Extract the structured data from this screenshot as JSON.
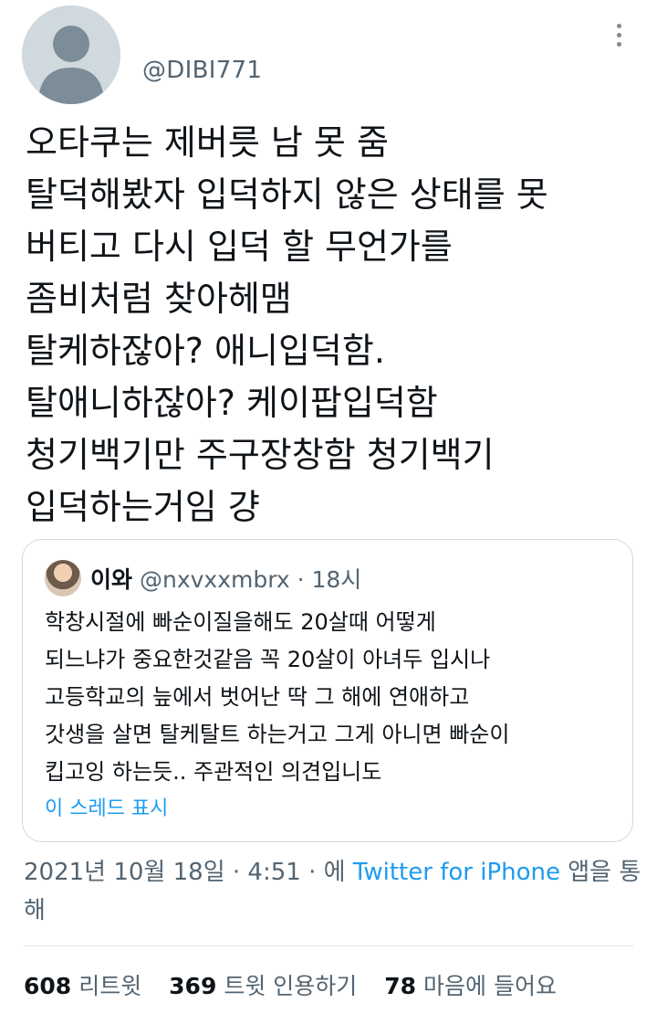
{
  "author": {
    "handle": "@DIBI771",
    "avatar_icon": "default-profile-icon"
  },
  "more_icon": "vertical-ellipsis-icon",
  "tweet": {
    "lines": [
      "오타쿠는 제버릇 남 못 줌",
      "탈덕해봤자 입덕하지 않은 상태를 못",
      "버티고 다시 입덕 할 무언가를",
      "좀비처럼 찾아헤맴",
      "탈케하잖아? 애니입덕함.",
      "탈애니하잖아? 케이팝입덕함",
      "청기백기만 주구장창함 청기백기",
      "입덕하는거임 걍"
    ]
  },
  "quote": {
    "name": "이와",
    "handle_time": "@nxvxxmbrx · 18시",
    "lines": [
      "학창시절에 빠순이질을해도 20살때 어떻게",
      "되느냐가 중요한것같음 꼭 20살이 아녀두 입시나",
      "고등학교의 늪에서 벗어난 딱 그 해에 연애하고",
      "갓생을 살면 탈케탈트 하는거고 그게 아니면 빠순이",
      "킵고잉 하는듯.. 주관적인 의견입니도"
    ],
    "show_thread": "이 스레드 표시"
  },
  "meta": {
    "datetime": "2021년 10월 18일 · 4:51 · 에 ",
    "source": "Twitter for iPhone",
    "suffix": " 앱을 통해"
  },
  "stats": [
    {
      "count": "608",
      "label": "리트윗"
    },
    {
      "count": "369",
      "label": "트윗 인용하기"
    },
    {
      "count": "78",
      "label": "마음에 들어요"
    }
  ],
  "colors": {
    "accent": "#1d9bf0",
    "secondary_text": "#536471",
    "border": "#cfd9de"
  }
}
